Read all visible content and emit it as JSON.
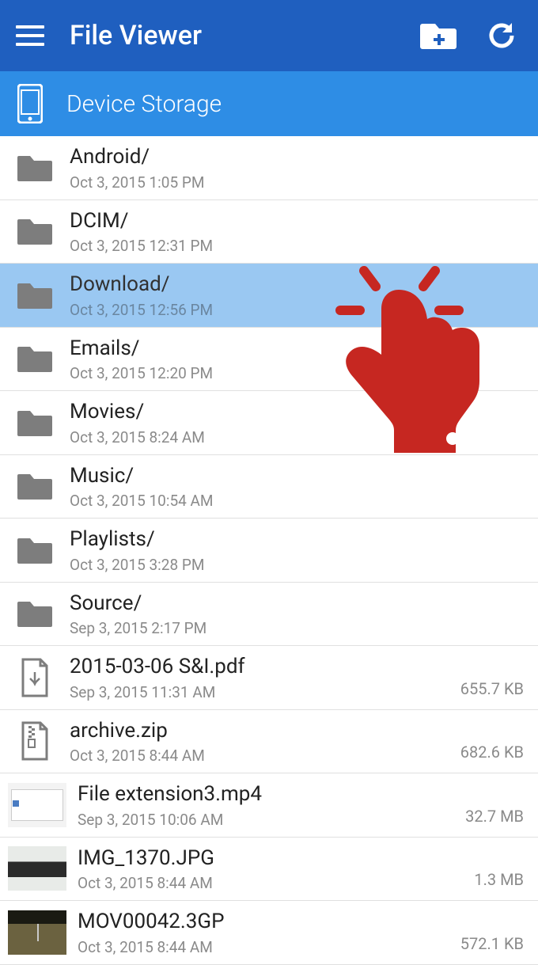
{
  "header": {
    "title": "File Viewer"
  },
  "breadcrumb": {
    "label": "Device Storage"
  },
  "items": [
    {
      "type": "folder",
      "name": "Android/",
      "date": "Oct 3, 2015 1:05 PM",
      "size": "",
      "selected": false
    },
    {
      "type": "folder",
      "name": "DCIM/",
      "date": "Oct 3, 2015 12:31 PM",
      "size": "",
      "selected": false
    },
    {
      "type": "folder",
      "name": "Download/",
      "date": "Oct 3, 2015 12:56 PM",
      "size": "",
      "selected": true
    },
    {
      "type": "folder",
      "name": "Emails/",
      "date": "Oct 3, 2015 12:20 PM",
      "size": "",
      "selected": false
    },
    {
      "type": "folder",
      "name": "Movies/",
      "date": "Oct 3, 2015 8:24 AM",
      "size": "",
      "selected": false
    },
    {
      "type": "folder",
      "name": "Music/",
      "date": "Oct 3, 2015 10:54 AM",
      "size": "",
      "selected": false
    },
    {
      "type": "folder",
      "name": "Playlists/",
      "date": "Oct 3, 2015 3:28 PM",
      "size": "",
      "selected": false
    },
    {
      "type": "folder",
      "name": "Source/",
      "date": "Sep 3, 2015 2:17 PM",
      "size": "",
      "selected": false
    },
    {
      "type": "pdf",
      "name": "2015-03-06 S&I.pdf",
      "date": "Sep 3, 2015 11:31 AM",
      "size": "655.7 KB",
      "selected": false
    },
    {
      "type": "zip",
      "name": "archive.zip",
      "date": "Oct 3, 2015 8:44 AM",
      "size": "682.6 KB",
      "selected": false
    },
    {
      "type": "video",
      "name": "File extension3.mp4",
      "date": "Sep 3, 2015 10:06 AM",
      "size": "32.7 MB",
      "selected": false
    },
    {
      "type": "image",
      "name": "IMG_1370.JPG",
      "date": "Oct 3, 2015 8:44 AM",
      "size": "1.3 MB",
      "selected": false
    },
    {
      "type": "video2",
      "name": "MOV00042.3GP",
      "date": "Oct 3, 2015 8:44 AM",
      "size": "572.1 KB",
      "selected": false
    }
  ]
}
